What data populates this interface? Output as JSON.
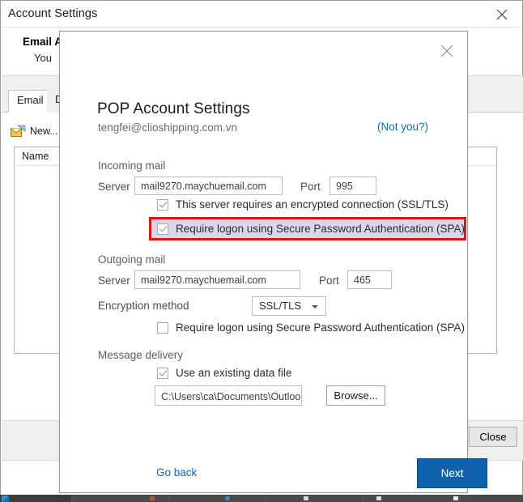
{
  "background_window": {
    "title": "Account Settings",
    "close_icon": "close-icon",
    "heading": "Email A",
    "subheading": "You ",
    "tabs": [
      {
        "label": "Email",
        "active": true
      },
      {
        "label": "Da",
        "active": false
      }
    ],
    "new_button": {
      "label": "New...",
      "icon": "new-mail-icon"
    },
    "list": {
      "columns": [
        "Name"
      ],
      "rows": []
    },
    "close_button": "Close"
  },
  "dialog": {
    "close_icon": "close-icon",
    "title": "POP Account Settings",
    "email": "tengfei@clioshipping.com.vn",
    "not_you_link": "(Not you?)",
    "incoming": {
      "section_label": "Incoming mail",
      "server_label": "Server",
      "server_value": "mail9270.maychuemail.com",
      "port_label": "Port",
      "port_value": "995",
      "ssl_checkbox": {
        "label": "This server requires an encrypted connection (SSL/TLS)",
        "checked": true
      },
      "spa_checkbox": {
        "label": "Require logon using Secure Password Authentication (SPA)",
        "checked": true,
        "highlighted": true,
        "highlight_border_color": "#e51212",
        "highlight_fill_color": "#d9d6ef"
      }
    },
    "outgoing": {
      "section_label": "Outgoing mail",
      "server_label": "Server",
      "server_value": "mail9270.maychuemail.com",
      "port_label": "Port",
      "port_value": "465",
      "encryption_label": "Encryption method",
      "encryption_value": "SSL/TLS",
      "encryption_options": [
        "SSL/TLS"
      ],
      "spa_checkbox": {
        "label": "Require logon using Secure Password Authentication (SPA)",
        "checked": false
      }
    },
    "message_delivery": {
      "section_label": "Message delivery",
      "use_existing_checkbox": {
        "label": "Use an existing data file",
        "checked": true
      },
      "data_file_path": "C:\\Users\\ca\\Documents\\Outlook 文件\\t",
      "browse_button": "Browse..."
    },
    "footer": {
      "go_back_link": "Go back",
      "next_button": "Next",
      "accent_color": "#0f62ad",
      "link_color": "#1267b5"
    }
  }
}
